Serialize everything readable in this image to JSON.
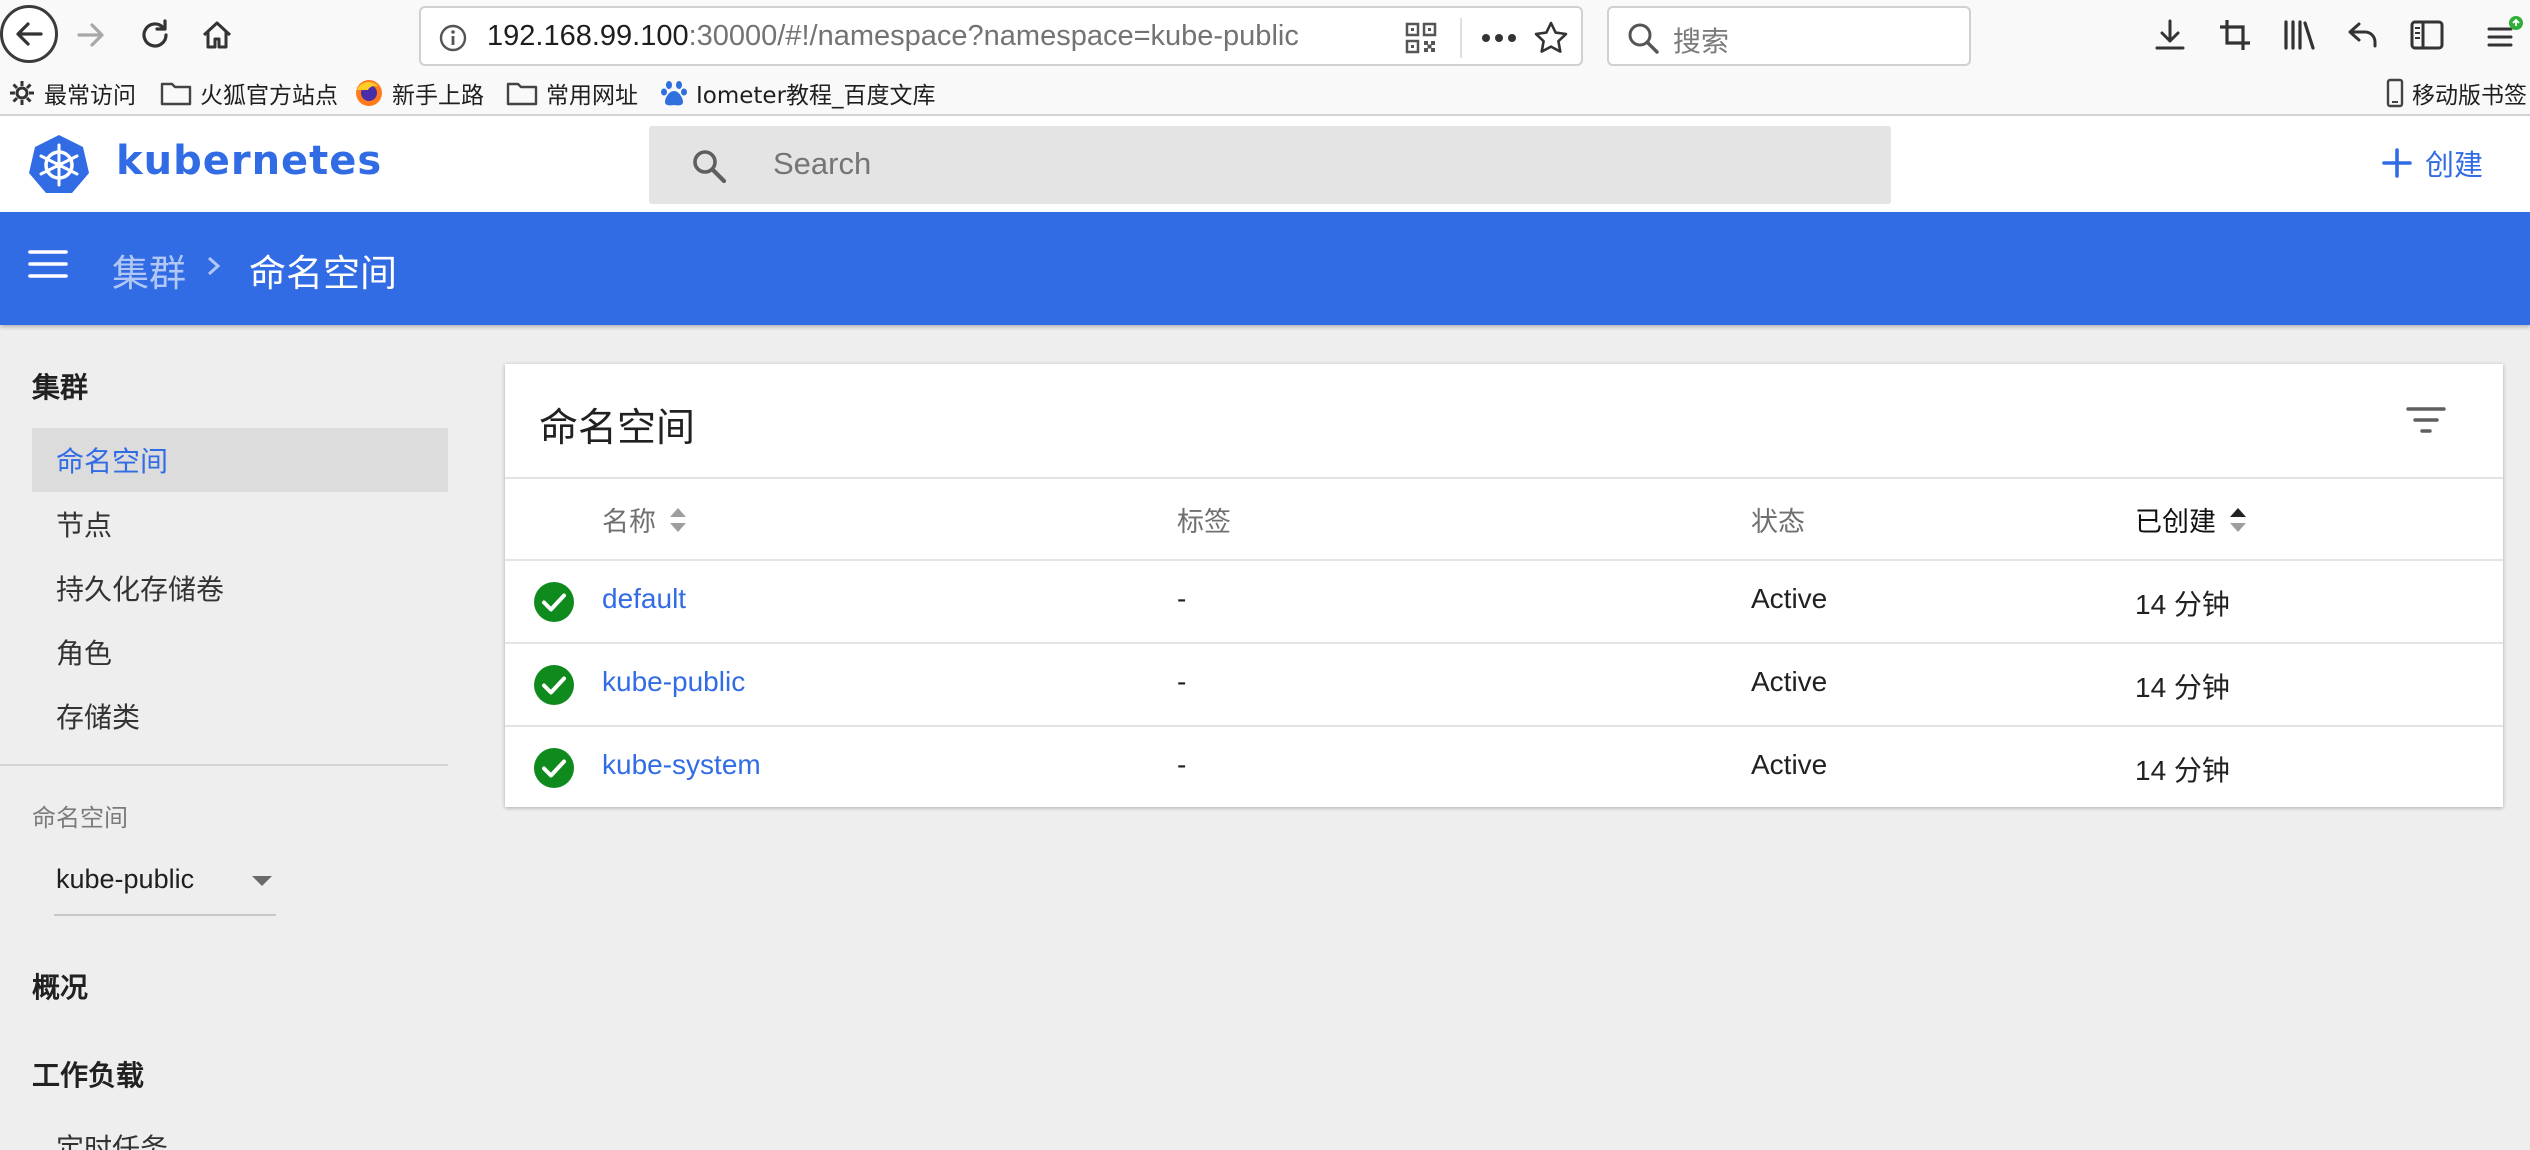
{
  "browser": {
    "url_host": "192.168.99.100",
    "url_rest": ":30000/#!/namespace?namespace=kube-public",
    "search_placeholder": "搜索",
    "bookmarks": [
      "最常访问",
      "火狐官方站点",
      "新手上路",
      "常用网址",
      "Iometer教程_百度文库"
    ],
    "mobile_bookmarks": "移动版书签"
  },
  "header": {
    "brand": "kubernetes",
    "search_placeholder": "Search",
    "create_label": "创建",
    "create_icon": "plus-icon"
  },
  "breadcrumb": {
    "parent": "集群",
    "current": "命名空间"
  },
  "sidebar": {
    "cluster_heading": "集群",
    "cluster_items": [
      {
        "label": "命名空间",
        "active": true
      },
      {
        "label": "节点",
        "active": false
      },
      {
        "label": "持久化存储卷",
        "active": false
      },
      {
        "label": "角色",
        "active": false
      },
      {
        "label": "存储类",
        "active": false
      }
    ],
    "namespace_label": "命名空间",
    "namespace_value": "kube-public",
    "overview_heading": "概况",
    "workloads_heading": "工作负载",
    "workloads_items": [
      "定时任务"
    ]
  },
  "card": {
    "title": "命名空间",
    "columns": {
      "name": "名称",
      "labels": "标签",
      "status": "状态",
      "created": "已创建"
    },
    "rows": [
      {
        "name": "default",
        "labels": "-",
        "status": "Active",
        "created": "14 分钟"
      },
      {
        "name": "kube-public",
        "labels": "-",
        "status": "Active",
        "created": "14 分钟"
      },
      {
        "name": "kube-system",
        "labels": "-",
        "status": "Active",
        "created": "14 分钟"
      }
    ]
  },
  "colors": {
    "brand": "#326ce5",
    "status_ok": "#0f8b1e",
    "sidebar_active_bg": "#dcdcdc"
  }
}
